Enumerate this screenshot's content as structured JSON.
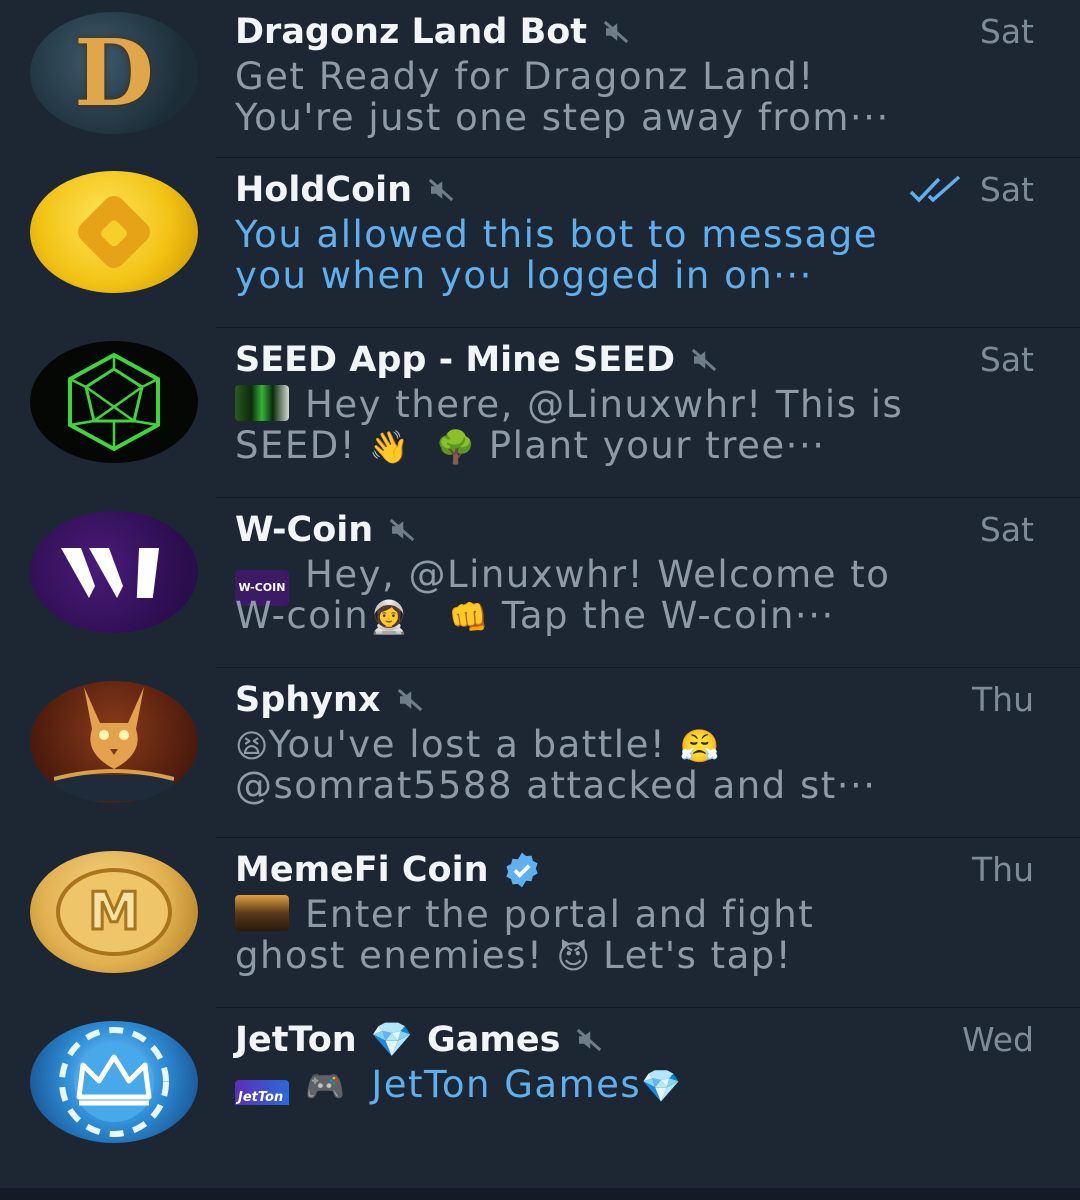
{
  "chats": [
    {
      "name": "Dragonz Land Bot",
      "time": "Sat",
      "muted": true,
      "preview_line1": "Get Ready for Dragonz Land!",
      "preview_line2": "You're just one step away from···",
      "avatar_letter": "D"
    },
    {
      "name": "HoldCoin",
      "time": "Sat",
      "muted": true,
      "read_receipt": "double-check-icon",
      "preview_line1": "You allowed this bot to message",
      "preview_line2": "you when you logged in on···"
    },
    {
      "name": "SEED App - Mine SEED",
      "time": "Sat",
      "muted": true,
      "preview_line1": "Hey there, @Linuxwhr! This is",
      "preview_line2a": "SEED! ",
      "preview_emoji1": "👋",
      "preview_emoji2": "🌳",
      "preview_line2b": " Plant your tree···"
    },
    {
      "name": "W-Coin",
      "time": "Sat",
      "muted": true,
      "thumb_text": "W-COIN",
      "preview_line1": "Hey, @Linuxwhr! Welcome to",
      "preview_line2a": "W-coin",
      "preview_emoji1": "👩‍🚀",
      "preview_emoji2": "👊",
      "preview_line2b": " Tap the W-coin···"
    },
    {
      "name": "Sphynx",
      "time": "Thu",
      "muted": true,
      "preview_emoji1": "😫",
      "preview_line1": "You've lost a battle! ",
      "preview_emoji2": "😤",
      "preview_line2": "@somrat5588 attacked and st···"
    },
    {
      "name": "MemeFi Coin",
      "time": "Thu",
      "verified": true,
      "preview_line1": "Enter the portal and fight",
      "preview_line2a": "ghost enemies! ",
      "preview_emoji1": "😈",
      "preview_line2b": " Let's tap!",
      "avatar_letter": "M"
    },
    {
      "name_a": "JetTon",
      "name_emoji": "💎",
      "name_b": "Games",
      "time": "Wed",
      "muted": true,
      "thumb_text": "JetTon",
      "preview_emoji1": "🎮",
      "preview_line1": "JetTon Games",
      "preview_emoji2": "💎"
    }
  ],
  "colors": {
    "background": "#1d2733",
    "name": "#f1f5f8",
    "preview": "#8e9ba6",
    "link_blue": "#5fb0ef",
    "time": "#7e8c99"
  }
}
